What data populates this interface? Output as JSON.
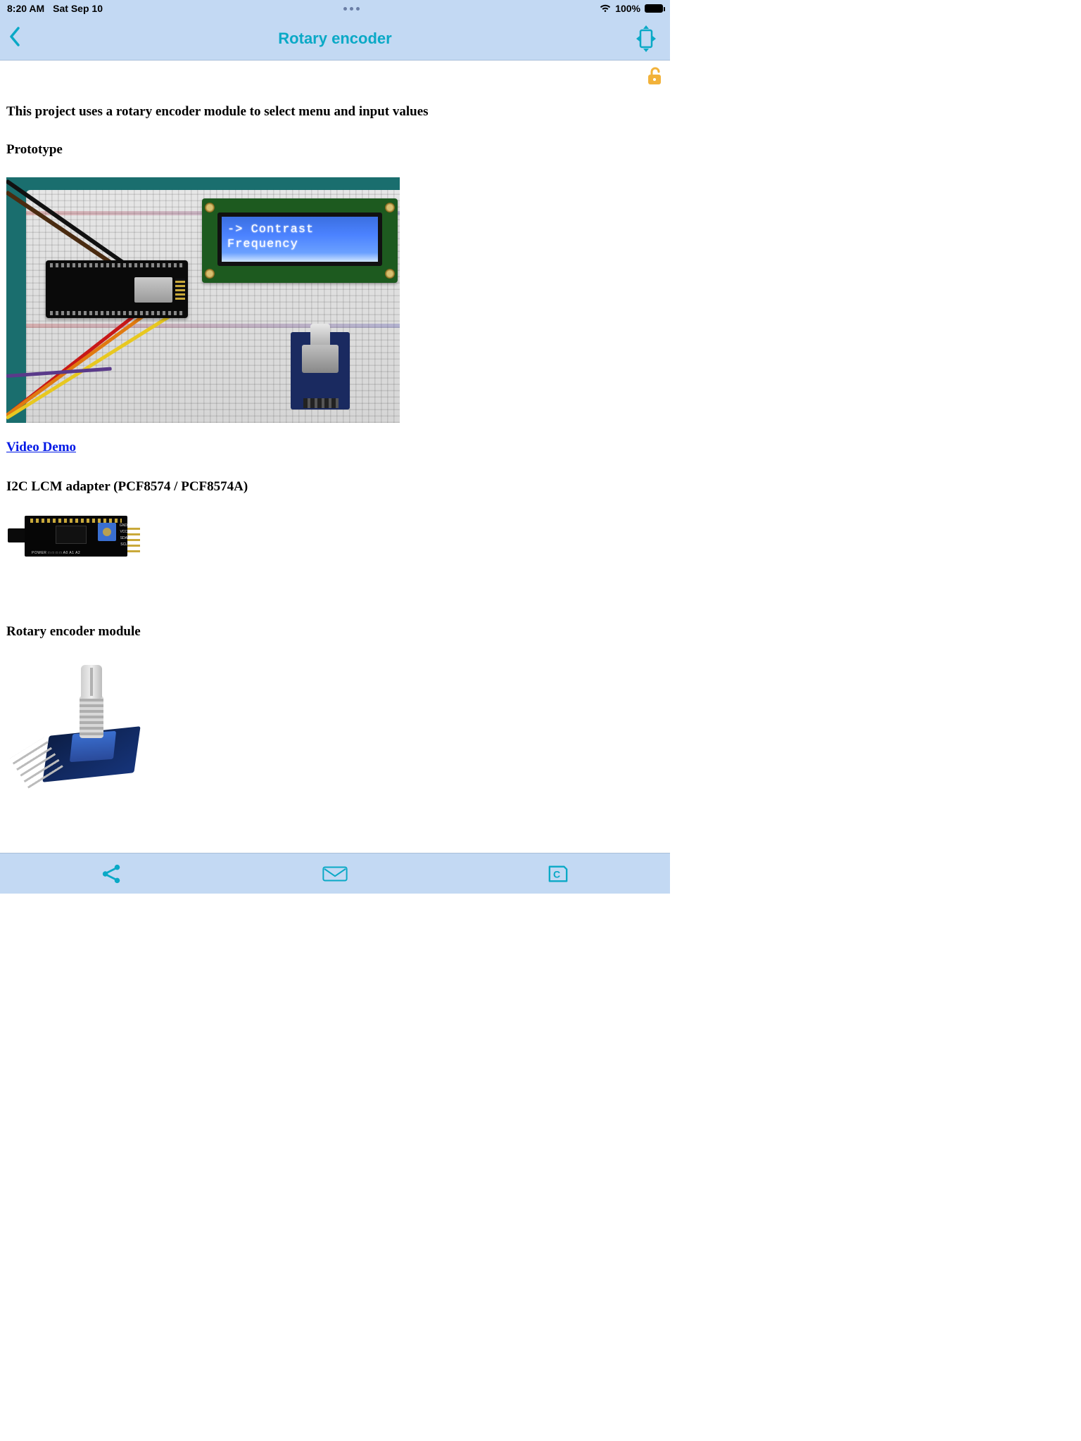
{
  "status": {
    "time": "8:20 AM",
    "date": "Sat Sep 10",
    "battery_pct": "100%"
  },
  "nav": {
    "title": "Rotary encoder"
  },
  "content": {
    "intro": "This project uses a rotary encoder module to select menu and input values",
    "prototype_heading": "Prototype",
    "lcd_line1": "-> Contrast",
    "lcd_line2": "   Frequency",
    "video_link": "Video Demo",
    "i2c_heading": "I2C LCM adapter (PCF8574 / PCF8574A)",
    "i2c_silk_bottom": "POWER  □ □ □ □  A0 A1 A2",
    "i2c_silk_side": "GND\nVCC\nSDA\nSCL",
    "rotary_heading": "Rotary encoder module"
  },
  "toolbar": {
    "share": "share",
    "mail": "mail",
    "code": "C"
  }
}
